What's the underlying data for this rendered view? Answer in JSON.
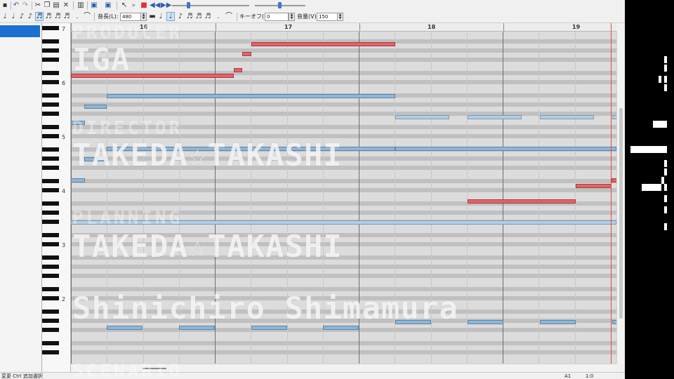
{
  "toolbar": {
    "length_label": "音長(L):",
    "length_value": "480",
    "keyoff_label": "キーオフ(K):",
    "keyoff_value": "0",
    "volume_label": "音量(V):",
    "volume_value": "150"
  },
  "ruler": {
    "measures": [
      "16",
      "17",
      "18",
      "19"
    ]
  },
  "piano": {
    "octave_labels": [
      "7",
      "6",
      "5",
      "4",
      "3",
      "2"
    ]
  },
  "credits": {
    "producer_role": "PRODUCER",
    "producer_name": "IGA",
    "director_role": "DIRECTOR",
    "director_name": "TAKEDA☆TAKASHI",
    "planning_role": "PLANNING",
    "planning_name_1": "TAKEDA☆TAKASHI",
    "planning_name_2": "Shinichiro Shimamura",
    "scenario_role": "SCENARIO"
  },
  "statusbar": {
    "left_text": "変更  Ctrl 追加選択",
    "position": "A1",
    "time": "1:0"
  },
  "colors": {
    "note_red": "#e06468",
    "note_blue": "#90b6d6",
    "selection": "#1a6fd1",
    "playhead": "#e24a4a"
  }
}
